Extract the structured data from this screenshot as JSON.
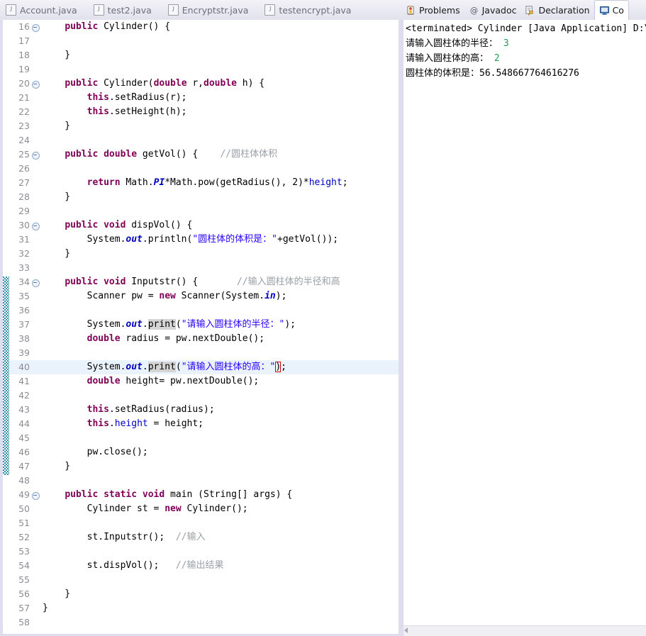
{
  "editor": {
    "tabs": [
      {
        "label": "Account.java",
        "icon": "java-file-icon",
        "active": false
      },
      {
        "label": "test2.java",
        "icon": "java-file-icon",
        "active": false
      },
      {
        "label": "Encryptstr.java",
        "icon": "java-file-icon",
        "active": false
      },
      {
        "label": "testencrypt.java",
        "icon": "java-file-icon",
        "active": false
      }
    ],
    "current_line": 40,
    "change_marker_from": 34,
    "change_marker_to": 47,
    "lines": [
      {
        "n": 16,
        "fold": true,
        "tokens": [
          {
            "t": "    ",
            "c": "pln"
          },
          {
            "t": "public",
            "c": "kw"
          },
          {
            "t": " Cylinder() {",
            "c": "pln"
          }
        ]
      },
      {
        "n": 17,
        "fold": false,
        "tokens": []
      },
      {
        "n": 18,
        "fold": false,
        "tokens": [
          {
            "t": "    }",
            "c": "pln"
          }
        ]
      },
      {
        "n": 19,
        "fold": false,
        "tokens": []
      },
      {
        "n": 20,
        "fold": true,
        "tokens": [
          {
            "t": "    ",
            "c": "pln"
          },
          {
            "t": "public",
            "c": "kw"
          },
          {
            "t": " Cylinder(",
            "c": "pln"
          },
          {
            "t": "double",
            "c": "kw"
          },
          {
            "t": " r,",
            "c": "pln"
          },
          {
            "t": "double",
            "c": "kw"
          },
          {
            "t": " h) {",
            "c": "pln"
          }
        ]
      },
      {
        "n": 21,
        "fold": false,
        "tokens": [
          {
            "t": "        ",
            "c": "pln"
          },
          {
            "t": "this",
            "c": "kw"
          },
          {
            "t": ".setRadius(r);",
            "c": "pln"
          }
        ]
      },
      {
        "n": 22,
        "fold": false,
        "tokens": [
          {
            "t": "        ",
            "c": "pln"
          },
          {
            "t": "this",
            "c": "kw"
          },
          {
            "t": ".setHeight(h);",
            "c": "pln"
          }
        ]
      },
      {
        "n": 23,
        "fold": false,
        "tokens": [
          {
            "t": "    }",
            "c": "pln"
          }
        ]
      },
      {
        "n": 24,
        "fold": false,
        "tokens": []
      },
      {
        "n": 25,
        "fold": true,
        "tokens": [
          {
            "t": "    ",
            "c": "pln"
          },
          {
            "t": "public double",
            "c": "kw"
          },
          {
            "t": " getVol() {    ",
            "c": "pln"
          },
          {
            "t": "//圆柱体体积",
            "c": "cmt"
          }
        ]
      },
      {
        "n": 26,
        "fold": false,
        "tokens": []
      },
      {
        "n": 27,
        "fold": false,
        "tokens": [
          {
            "t": "        ",
            "c": "pln"
          },
          {
            "t": "return",
            "c": "kw"
          },
          {
            "t": " Math.",
            "c": "pln"
          },
          {
            "t": "PI",
            "c": "sfld"
          },
          {
            "t": "*Math.",
            "c": "pln"
          },
          {
            "t": "pow",
            "c": "pln"
          },
          {
            "t": "(getRadius(), 2)*",
            "c": "pln"
          },
          {
            "t": "height",
            "c": "fld"
          },
          {
            "t": ";",
            "c": "pln"
          }
        ]
      },
      {
        "n": 28,
        "fold": false,
        "tokens": [
          {
            "t": "    }",
            "c": "pln"
          }
        ]
      },
      {
        "n": 29,
        "fold": false,
        "tokens": []
      },
      {
        "n": 30,
        "fold": true,
        "tokens": [
          {
            "t": "    ",
            "c": "pln"
          },
          {
            "t": "public void",
            "c": "kw"
          },
          {
            "t": " dispVol() {",
            "c": "pln"
          }
        ]
      },
      {
        "n": 31,
        "fold": false,
        "tokens": [
          {
            "t": "        System.",
            "c": "pln"
          },
          {
            "t": "out",
            "c": "sfld"
          },
          {
            "t": ".println(",
            "c": "pln"
          },
          {
            "t": "\"圆柱体的体积是：\"",
            "c": "str"
          },
          {
            "t": "+getVol());",
            "c": "pln"
          }
        ]
      },
      {
        "n": 32,
        "fold": false,
        "tokens": [
          {
            "t": "    }",
            "c": "pln"
          }
        ]
      },
      {
        "n": 33,
        "fold": false,
        "tokens": []
      },
      {
        "n": 34,
        "fold": true,
        "tokens": [
          {
            "t": "    ",
            "c": "pln"
          },
          {
            "t": "public void",
            "c": "kw"
          },
          {
            "t": " Inputstr() {       ",
            "c": "pln"
          },
          {
            "t": "//输入圆柱体的半径和高",
            "c": "cmt"
          }
        ]
      },
      {
        "n": 35,
        "fold": false,
        "tokens": [
          {
            "t": "        Scanner pw = ",
            "c": "pln"
          },
          {
            "t": "new",
            "c": "kw"
          },
          {
            "t": " Scanner(System.",
            "c": "pln"
          },
          {
            "t": "in",
            "c": "sfld"
          },
          {
            "t": ");",
            "c": "pln"
          }
        ]
      },
      {
        "n": 36,
        "fold": false,
        "tokens": []
      },
      {
        "n": 37,
        "fold": false,
        "tokens": [
          {
            "t": "        System.",
            "c": "pln"
          },
          {
            "t": "out",
            "c": "sfld"
          },
          {
            "t": ".",
            "c": "pln"
          },
          {
            "t": "print",
            "c": "occ"
          },
          {
            "t": "(",
            "c": "pln"
          },
          {
            "t": "\"请输入圆柱体的半径：\"",
            "c": "str"
          },
          {
            "t": ");",
            "c": "pln"
          }
        ]
      },
      {
        "n": 38,
        "fold": false,
        "tokens": [
          {
            "t": "        ",
            "c": "pln"
          },
          {
            "t": "double",
            "c": "kw"
          },
          {
            "t": " radius = pw.nextDouble();",
            "c": "pln"
          }
        ]
      },
      {
        "n": 39,
        "fold": false,
        "tokens": []
      },
      {
        "n": 40,
        "fold": false,
        "tokens": [
          {
            "t": "        System.",
            "c": "pln"
          },
          {
            "t": "out",
            "c": "sfld"
          },
          {
            "t": ".",
            "c": "pln"
          },
          {
            "t": "print",
            "c": "occ"
          },
          {
            "t": "(",
            "c": "pln"
          },
          {
            "t": "\"请输入圆柱体的高：\"",
            "c": "str"
          },
          {
            "t": ")",
            "c": "brk"
          },
          {
            "t": ";",
            "c": "pln"
          }
        ]
      },
      {
        "n": 41,
        "fold": false,
        "tokens": [
          {
            "t": "        ",
            "c": "pln"
          },
          {
            "t": "double",
            "c": "kw"
          },
          {
            "t": " height= pw.nextDouble();",
            "c": "pln"
          }
        ]
      },
      {
        "n": 42,
        "fold": false,
        "tokens": []
      },
      {
        "n": 43,
        "fold": false,
        "tokens": [
          {
            "t": "        ",
            "c": "pln"
          },
          {
            "t": "this",
            "c": "kw"
          },
          {
            "t": ".setRadius(radius);",
            "c": "pln"
          }
        ]
      },
      {
        "n": 44,
        "fold": false,
        "tokens": [
          {
            "t": "        ",
            "c": "pln"
          },
          {
            "t": "this",
            "c": "kw"
          },
          {
            "t": ".",
            "c": "pln"
          },
          {
            "t": "height",
            "c": "fld"
          },
          {
            "t": " = height;",
            "c": "pln"
          }
        ]
      },
      {
        "n": 45,
        "fold": false,
        "tokens": []
      },
      {
        "n": 46,
        "fold": false,
        "tokens": [
          {
            "t": "        pw.close();",
            "c": "pln"
          }
        ]
      },
      {
        "n": 47,
        "fold": false,
        "tokens": [
          {
            "t": "    }",
            "c": "pln"
          }
        ]
      },
      {
        "n": 48,
        "fold": false,
        "tokens": []
      },
      {
        "n": 49,
        "fold": true,
        "tokens": [
          {
            "t": "    ",
            "c": "pln"
          },
          {
            "t": "public static void",
            "c": "kw"
          },
          {
            "t": " main (String[] args) {",
            "c": "pln"
          }
        ]
      },
      {
        "n": 50,
        "fold": false,
        "tokens": [
          {
            "t": "        Cylinder st = ",
            "c": "pln"
          },
          {
            "t": "new",
            "c": "kw"
          },
          {
            "t": " Cylinder();",
            "c": "pln"
          }
        ]
      },
      {
        "n": 51,
        "fold": false,
        "tokens": []
      },
      {
        "n": 52,
        "fold": false,
        "tokens": [
          {
            "t": "        st.Inputstr();  ",
            "c": "pln"
          },
          {
            "t": "//输入",
            "c": "cmt"
          }
        ]
      },
      {
        "n": 53,
        "fold": false,
        "tokens": []
      },
      {
        "n": 54,
        "fold": false,
        "tokens": [
          {
            "t": "        st.dispVol();   ",
            "c": "pln"
          },
          {
            "t": "//输出结果",
            "c": "cmt"
          }
        ]
      },
      {
        "n": 55,
        "fold": false,
        "tokens": []
      },
      {
        "n": 56,
        "fold": false,
        "tokens": [
          {
            "t": "    }",
            "c": "pln"
          }
        ]
      },
      {
        "n": 57,
        "fold": false,
        "tokens": [
          {
            "t": "}",
            "c": "pln"
          }
        ]
      },
      {
        "n": 58,
        "fold": false,
        "tokens": []
      }
    ]
  },
  "right_panel": {
    "tabs": [
      {
        "label": "Problems",
        "icon": "problems-icon",
        "active": false
      },
      {
        "label": "Javadoc",
        "icon": "javadoc-at-icon",
        "active": false
      },
      {
        "label": "Declaration",
        "icon": "declaration-icon",
        "active": false
      },
      {
        "label": "Co",
        "icon": "console-icon",
        "active": true
      }
    ],
    "console": {
      "header": "<terminated> Cylinder [Java Application] D:\\M",
      "lines": [
        {
          "prompt": "请输入圆柱体的半径：",
          "input": "3"
        },
        {
          "prompt": "请输入圆柱体的高：",
          "input": "2"
        },
        {
          "prompt": "圆柱体的体积是：56.548667764616276",
          "input": ""
        }
      ]
    }
  },
  "colors": {
    "keyword": "#7f0055",
    "string": "#2a00ff",
    "comment": "#9aa0a6",
    "field": "#0000c0",
    "current_line": "#eaf2fb",
    "occurrence": "#d4d4d4",
    "change_bar": "#2b8a9e",
    "console_input": "#1f9e5a"
  }
}
